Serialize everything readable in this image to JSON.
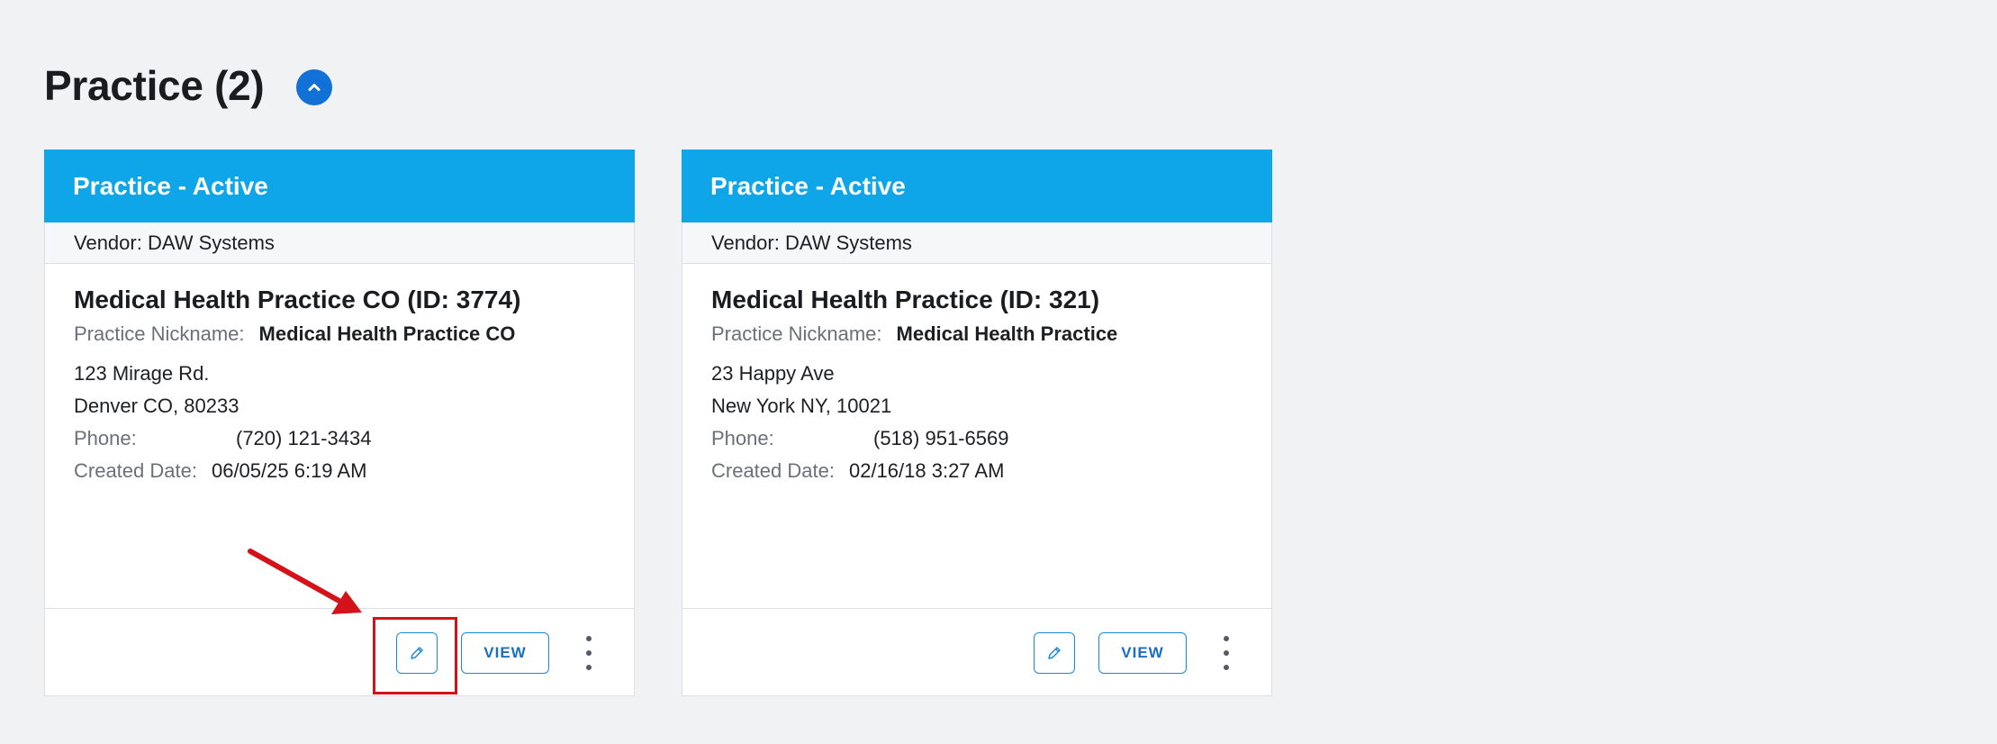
{
  "section": {
    "title": "Practice (2)",
    "collapse_icon": "chevron-up-icon",
    "accent_color": "#1271d6"
  },
  "cards": [
    {
      "status": "Practice - Active",
      "vendor": "Vendor: DAW Systems",
      "name": "Medical Health Practice CO (ID: 3774)",
      "nickname_label": "Practice Nickname:",
      "nickname": "Medical Health Practice CO",
      "address_line1": "123 Mirage Rd.",
      "address_line2": "Denver CO, 80233",
      "phone_label": "Phone:",
      "phone": "(720) 121-3434",
      "created_label": "Created Date:",
      "created": "06/05/25 6:19 AM",
      "view_label": "VIEW",
      "edit_icon": "pencil-icon",
      "more_icon": "more-vertical-icon"
    },
    {
      "status": "Practice - Active",
      "vendor": "Vendor: DAW Systems",
      "name": "Medical Health Practice (ID: 321)",
      "nickname_label": "Practice Nickname:",
      "nickname": "Medical Health Practice",
      "address_line1": "23 Happy Ave",
      "address_line2": "New York NY, 10021",
      "phone_label": "Phone:",
      "phone": "(518) 951-6569",
      "created_label": "Created Date:",
      "created": "02/16/18 3:27 AM",
      "view_label": "VIEW",
      "edit_icon": "pencil-icon",
      "more_icon": "more-vertical-icon"
    }
  ],
  "colors": {
    "card_header": "#0ea5e9",
    "button_border": "#1a8ad6",
    "annotation": "#d4121a"
  }
}
